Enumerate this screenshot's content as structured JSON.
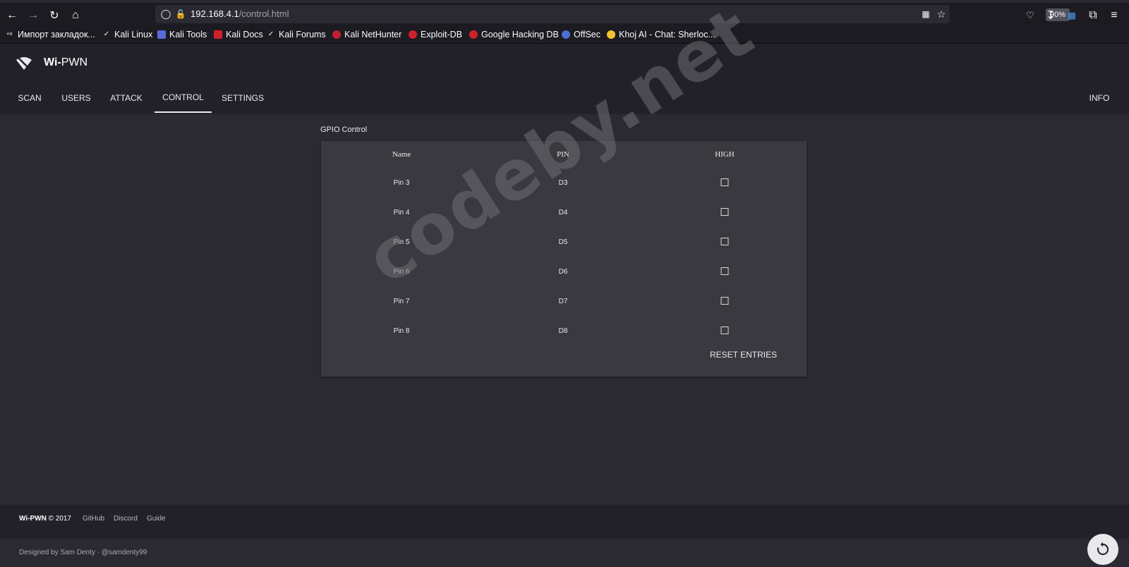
{
  "browser": {
    "url_host": "192.168.4.1",
    "url_path": "/control.html",
    "zoom": "90%",
    "bookmarks": [
      {
        "label": "Импорт закладок...",
        "icon": "import-icon"
      },
      {
        "label": "Kali Linux",
        "icon": "kali-dragon-icon"
      },
      {
        "label": "Kali Tools",
        "icon": "kali-tools-icon"
      },
      {
        "label": "Kali Docs",
        "icon": "kali-docs-icon"
      },
      {
        "label": "Kali Forums",
        "icon": "kali-dragon-icon"
      },
      {
        "label": "Kali NetHunter",
        "icon": "nethunter-icon"
      },
      {
        "label": "Exploit-DB",
        "icon": "exploit-db-icon"
      },
      {
        "label": "Google Hacking DB",
        "icon": "ghdb-icon"
      },
      {
        "label": "OffSec",
        "icon": "offsec-icon"
      },
      {
        "label": "Khoj AI - Chat: Sherloc...",
        "icon": "khoj-icon"
      }
    ]
  },
  "header": {
    "brand_bold": "Wi-",
    "brand_rest": "PWN",
    "tabs": [
      {
        "label": "SCAN"
      },
      {
        "label": "USERS"
      },
      {
        "label": "ATTACK"
      },
      {
        "label": "CONTROL",
        "active": true
      },
      {
        "label": "SETTINGS"
      }
    ],
    "info_label": "INFO"
  },
  "gpio": {
    "title": "GPIO Control",
    "columns": [
      "Name",
      "PIN",
      "HIGH"
    ],
    "rows": [
      {
        "name": "Pin 3",
        "pin": "D3",
        "high": false
      },
      {
        "name": "Pin 4",
        "pin": "D4",
        "high": false
      },
      {
        "name": "Pin 5",
        "pin": "D5",
        "high": false
      },
      {
        "name": "Pin 6",
        "pin": "D6",
        "high": false
      },
      {
        "name": "Pin 7",
        "pin": "D7",
        "high": false
      },
      {
        "name": "Pin 8",
        "pin": "D8",
        "high": false
      }
    ],
    "reset_label": "RESET ENTRIES"
  },
  "watermark": "codeby.net",
  "footer": {
    "brand": "Wi-PWN",
    "copyright": "© 2017",
    "links": [
      "GitHub",
      "Discord",
      "Guide"
    ],
    "credit": "Designed by Sam Denty · @samdenty99"
  },
  "colors": {
    "page_bg": "#2b2a33",
    "header_bg": "#222129",
    "card_bg": "#3a3940"
  }
}
